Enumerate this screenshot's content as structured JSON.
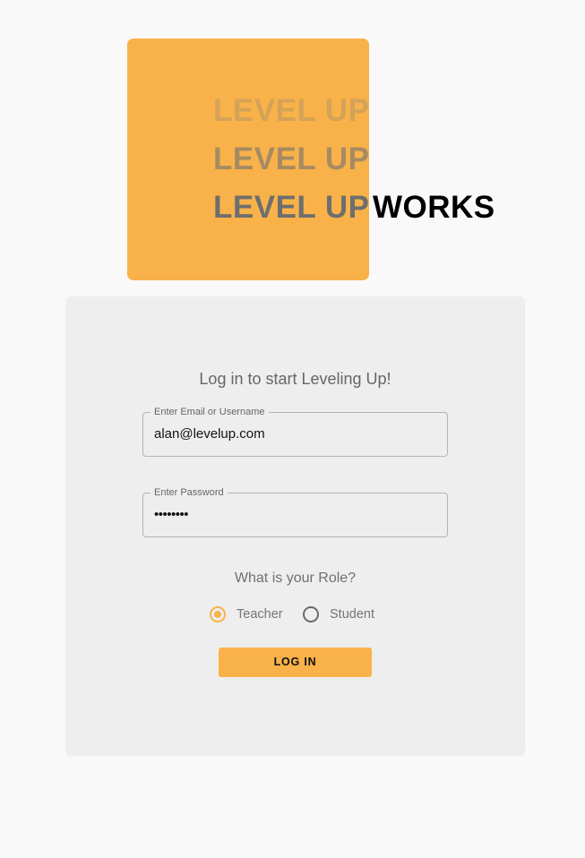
{
  "branding": {
    "logo_lines": [
      "LEVEL UP",
      "LEVEL UP",
      "LEVEL UP"
    ],
    "logo_suffix": "WORKS",
    "accent_color": "#f8b249"
  },
  "login": {
    "heading": "Log in to start Leveling Up!",
    "email": {
      "label": "Enter Email or Username",
      "value": "alan@levelup.com"
    },
    "password": {
      "label": "Enter Password",
      "masked_value": "••••••••"
    },
    "role": {
      "question": "What is your Role?",
      "options": [
        {
          "label": "Teacher",
          "selected": true
        },
        {
          "label": "Student",
          "selected": false
        }
      ]
    },
    "submit_label": "LOG IN"
  }
}
